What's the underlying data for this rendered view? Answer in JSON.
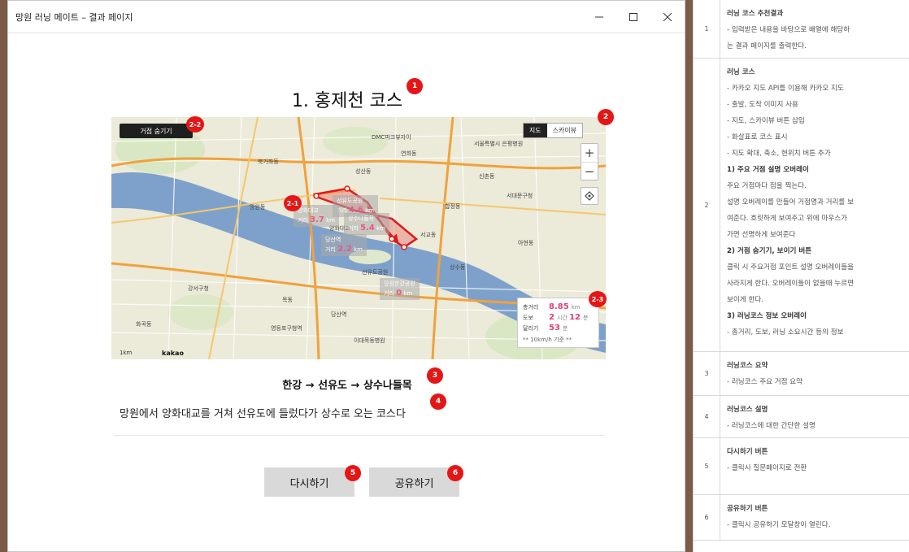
{
  "window": {
    "title": "망원 러닝 메이트 – 결과 페이지"
  },
  "course": {
    "title": "1. 홍제천 코스",
    "route_summary": "한강 → 선유도 → 상수나들목",
    "description": "망원에서 양화대교를 거쳐 선유도에 들렀다가 상수로 오는 코스다"
  },
  "map": {
    "toggle_button": "거점 숨기기",
    "type_map": "지도",
    "type_skyview": "스카이뷰",
    "zoom_in": "+",
    "zoom_out": "−",
    "scale_label": "1km",
    "logo": "kakao",
    "waypoints": [
      {
        "name": "선유도공원",
        "label": "거리",
        "distance": "4.6",
        "unit": "km"
      },
      {
        "name": "양화대교",
        "label": "거리",
        "distance": "3.7",
        "unit": "km"
      },
      {
        "name": "상수나들목",
        "label": "거리",
        "distance": "5.4",
        "unit": "km"
      },
      {
        "name": "당산역",
        "label": "거리",
        "distance": "2.2",
        "unit": "km"
      },
      {
        "name": "망원한강공원",
        "label": "거리",
        "distance": "0",
        "unit": "km"
      }
    ],
    "info": {
      "total_label": "총거리",
      "total_value": "8.85",
      "total_unit": "km",
      "walk_label": "도보",
      "walk_hours": "2",
      "walk_hours_unit": "시간",
      "walk_minutes": "12",
      "walk_minutes_unit": "분",
      "run_label": "달리기",
      "run_minutes": "53",
      "run_unit": "분",
      "note": "** 10km/h 기준 **"
    },
    "places": [
      "DMC파크뷰자이",
      "서울특별시 은평병원",
      "북가좌동",
      "성산동",
      "합정동",
      "망원동",
      "양화대교",
      "선유도공원",
      "당산역",
      "영등포구청역",
      "이대목동병원",
      "서대문구청",
      "아현동",
      "신촌동",
      "연희동",
      "강서구청",
      "화곡동",
      "목동",
      "상수동",
      "서교동"
    ],
    "colors": {
      "river": "#7ea1cb",
      "land": "#ecead9",
      "route": "#e01919",
      "major_road": "#f0a23c"
    }
  },
  "actions": {
    "retry": "다시하기",
    "share": "공유하기"
  },
  "badges": [
    "1",
    "2",
    "2-1",
    "2-2",
    "2-3",
    "3",
    "4",
    "5",
    "6"
  ],
  "spec": {
    "rows": [
      {
        "num": "1",
        "lines": [
          {
            "t": "러닝 코스 추천결과",
            "s": "h"
          },
          {
            "t": "- 입력받은 내용을 바탕으로 배열에 해당하",
            "s": ""
          },
          {
            "t": "는 결과 페이지를 출력한다.",
            "s": ""
          }
        ]
      },
      {
        "num": "2",
        "lines": [
          {
            "t": "러닝 코스",
            "s": "h"
          },
          {
            "t": "- 카카오 지도 API를 이용해 카카오 지도",
            "s": ""
          },
          {
            "t": "- 출발, 도착 이미지 사용",
            "s": ""
          },
          {
            "t": "- 지도, 스카이뷰 버튼 삽입",
            "s": ""
          },
          {
            "t": "- 화살표로 코스 표시",
            "s": ""
          },
          {
            "t": "- 지도 확대, 축소, 현위치 버튼 추가",
            "s": ""
          },
          {
            "t": "1) 주요 거점 설명 오버레이",
            "s": "b"
          },
          {
            "t": "주요 거점마다 점을 찍는다.",
            "s": ""
          },
          {
            "t": "설명 오버레이를 만들어 거점명과 거리를 보",
            "s": ""
          },
          {
            "t": "여준다. 흐릿하게 보여주고 위에 마우스가",
            "s": ""
          },
          {
            "t": "가면 선명하게 보여준다",
            "s": ""
          },
          {
            "t": "2) 거점 숨기기, 보이기 버튼",
            "s": "b"
          },
          {
            "t": "클릭 시 주요거점 포인트 설명 오버레이들을",
            "s": ""
          },
          {
            "t": "사라지게 한다. 오버레이들이 없을때 누르면",
            "s": ""
          },
          {
            "t": "보이게 한다.",
            "s": ""
          },
          {
            "t": "3) 러닝코스 정보 오버레이",
            "s": "b"
          },
          {
            "t": " - 총거리, 도보, 러닝 소요시간 등의 정보",
            "s": ""
          }
        ]
      },
      {
        "num": "3",
        "lines": [
          {
            "t": "러닝코스 요약",
            "s": "h"
          },
          {
            "t": "- 러닝코스 주요 거점 요약",
            "s": ""
          }
        ]
      },
      {
        "num": "4",
        "lines": [
          {
            "t": "러닝코스 설명",
            "s": "h"
          },
          {
            "t": "- 러닝코스에 대한 간단한 설명",
            "s": ""
          }
        ]
      },
      {
        "num": "5",
        "lines": [
          {
            "t": "다시하기 버튼",
            "s": "h"
          },
          {
            "t": "- 클릭시 질문페이지로 전환",
            "s": ""
          }
        ]
      },
      {
        "num": "6",
        "lines": [
          {
            "t": "공유하기 버튼",
            "s": "h"
          },
          {
            "t": "- 클릭시 공유하기 모달창이 열린다.",
            "s": ""
          }
        ]
      }
    ]
  }
}
